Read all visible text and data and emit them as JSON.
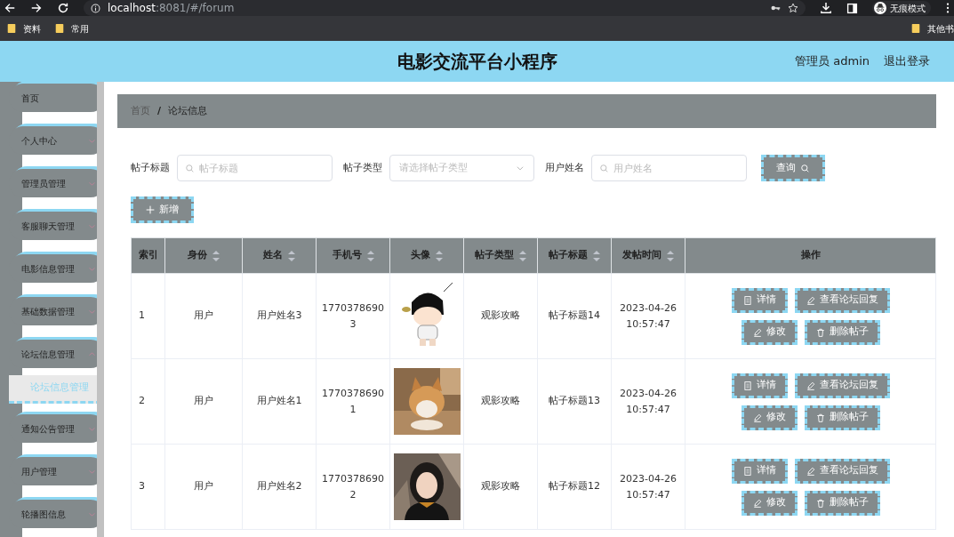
{
  "browser": {
    "url_host": "localhost",
    "url_rest": ":8081/#/forum",
    "incognito_label": "无痕模式",
    "bookmarks": [
      "资料",
      "常用"
    ],
    "other_bookmarks": "其他书"
  },
  "header": {
    "title": "电影交流平台小程序",
    "user": "管理员 admin",
    "logout": "退出登录"
  },
  "sidebar": {
    "items": [
      {
        "label": "首页",
        "has_arrow": false
      },
      {
        "label": "个人中心",
        "has_arrow": true,
        "expanded": false
      },
      {
        "label": "管理员管理",
        "has_arrow": true,
        "expanded": false
      },
      {
        "label": "客服聊天管理",
        "has_arrow": true,
        "expanded": false
      },
      {
        "label": "电影信息管理",
        "has_arrow": true,
        "expanded": false
      },
      {
        "label": "基础数据管理",
        "has_arrow": true,
        "expanded": false
      },
      {
        "label": "论坛信息管理",
        "has_arrow": true,
        "expanded": true,
        "children": [
          {
            "label": "论坛信息管理",
            "selected": true
          }
        ]
      },
      {
        "label": "通知公告管理",
        "has_arrow": true,
        "expanded": false
      },
      {
        "label": "用户管理",
        "has_arrow": true,
        "expanded": false
      },
      {
        "label": "轮播图信息",
        "has_arrow": true,
        "expanded": false
      }
    ]
  },
  "breadcrumb": {
    "items": [
      "首页",
      "论坛信息"
    ],
    "separator": "/"
  },
  "filters": [
    {
      "kind": "input",
      "label": "帖子标题",
      "placeholder": "帖子标题"
    },
    {
      "kind": "select",
      "label": "帖子类型",
      "placeholder": "请选择帖子类型"
    },
    {
      "kind": "input",
      "label": "用户姓名",
      "placeholder": "用户姓名"
    }
  ],
  "search_button": "查询",
  "add_button": "新增",
  "table": {
    "columns": [
      {
        "label": "索引",
        "sortable": false
      },
      {
        "label": "身份",
        "sortable": true
      },
      {
        "label": "姓名",
        "sortable": true
      },
      {
        "label": "手机号",
        "sortable": true
      },
      {
        "label": "头像",
        "sortable": true
      },
      {
        "label": "帖子类型",
        "sortable": true
      },
      {
        "label": "帖子标题",
        "sortable": true
      },
      {
        "label": "发帖时间",
        "sortable": true
      },
      {
        "label": "操作",
        "sortable": false
      }
    ],
    "rows": [
      {
        "index": "1",
        "identity": "用户",
        "name": "用户姓名3",
        "phone": "17703786903",
        "post_type": "观影攻略",
        "post_title": "帖子标题14",
        "time": "2023-04-26 10:57:47",
        "actions": [
          "详情",
          "查看论坛回复",
          "修改",
          "删除帖子"
        ]
      },
      {
        "index": "2",
        "identity": "用户",
        "name": "用户姓名1",
        "phone": "17703786901",
        "post_type": "观影攻略",
        "post_title": "帖子标题13",
        "time": "2023-04-26 10:57:47",
        "actions": [
          "详情",
          "查看论坛回复",
          "修改",
          "删除帖子"
        ]
      },
      {
        "index": "3",
        "identity": "用户",
        "name": "用户姓名2",
        "phone": "17703786902",
        "post_type": "观影攻略",
        "post_title": "帖子标题12",
        "time": "2023-04-26 10:57:47",
        "actions": [
          "详情",
          "查看论坛回复",
          "修改",
          "删除帖子"
        ]
      }
    ]
  }
}
